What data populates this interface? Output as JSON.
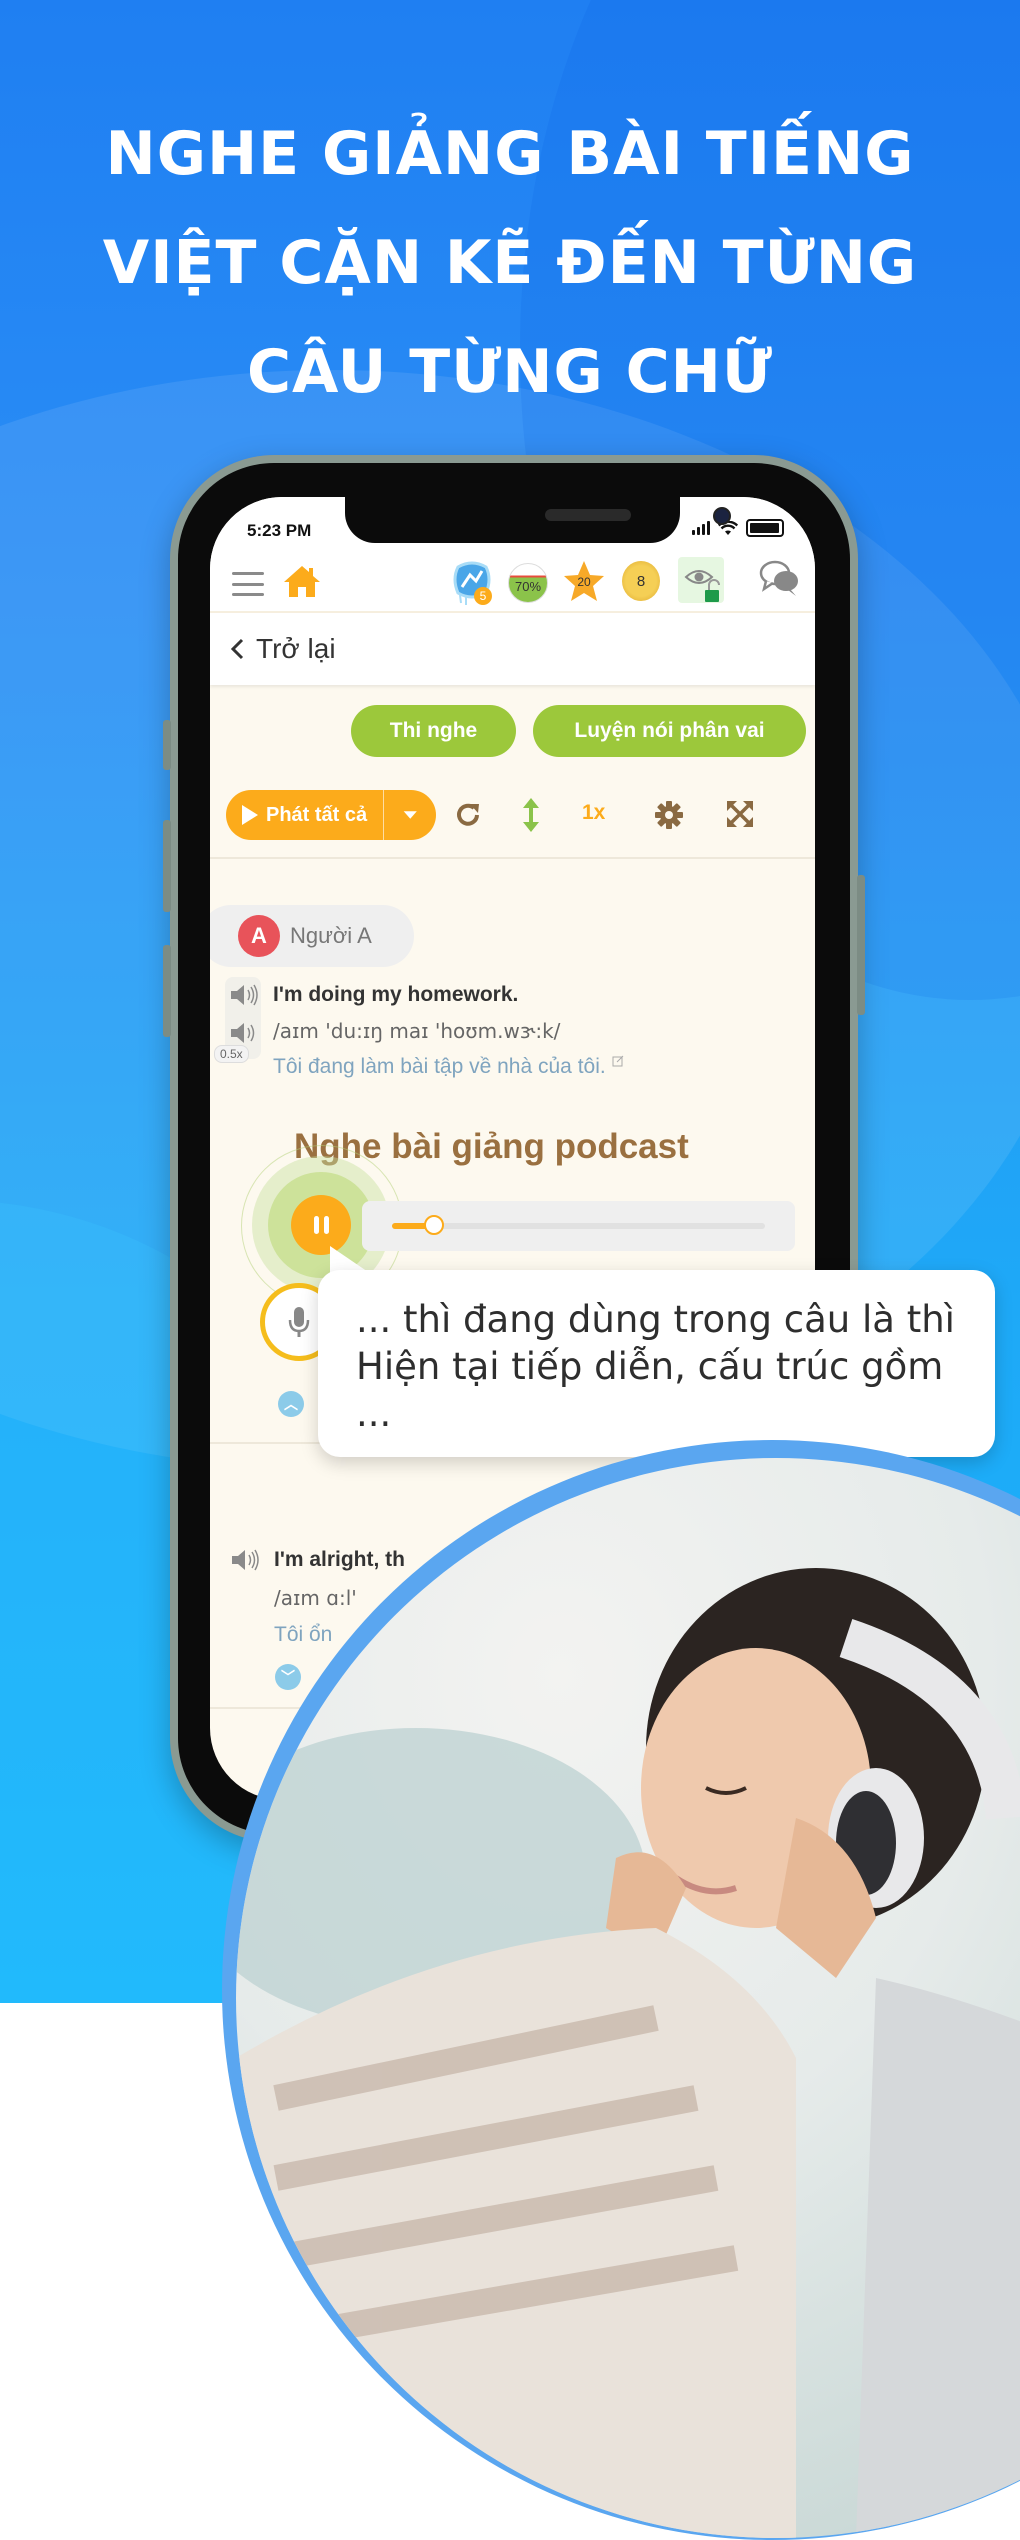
{
  "headline": {
    "lines": [
      "NGHE GIẢNG BÀI TIẾNG",
      "VIỆT CẶN KẼ ĐẾN TỪNG",
      "CÂU TỪNG CHỮ"
    ]
  },
  "status_bar": {
    "time": "5:23 PM"
  },
  "top_bar": {
    "streak_freeze_count": "5",
    "progress_percent": "70%",
    "progress_value": 0.7,
    "stars": "20",
    "coins": "8"
  },
  "nav": {
    "back_label": "Trở lại"
  },
  "actions": {
    "listen_test": "Thi nghe",
    "roleplay": "Luyện nói phân vai"
  },
  "toolbar": {
    "play_all": "Phát tất cả",
    "speed": "1x"
  },
  "dialogue": [
    {
      "speaker_initial": "A",
      "speaker_name": "Người A",
      "english": "I'm doing my homework.",
      "ipa": "/aɪm 'du:ɪŋ maɪ 'hoʊm.wɝ:k/",
      "vietnamese": "Tôi đang làm bài tập về nhà của tôi.",
      "slow_speed": "0.5x"
    },
    {
      "english": "I'm alright, th",
      "ipa": "/aɪm ɑ:l'",
      "vietnamese": "Tôi ổn"
    }
  ],
  "podcast": {
    "title": "Nghe bài giảng podcast",
    "progress": 0.11,
    "state": "playing"
  },
  "bubble": {
    "text": "... thì đang dùng trong câu là thì Hiện tại tiếp diễn, cấu trúc gồm ..."
  },
  "colors": {
    "accent_orange": "#fcab1b",
    "accent_green": "#9cc83b",
    "podcast_brown": "#9a7040",
    "background_blue": "#1f7ff2"
  }
}
